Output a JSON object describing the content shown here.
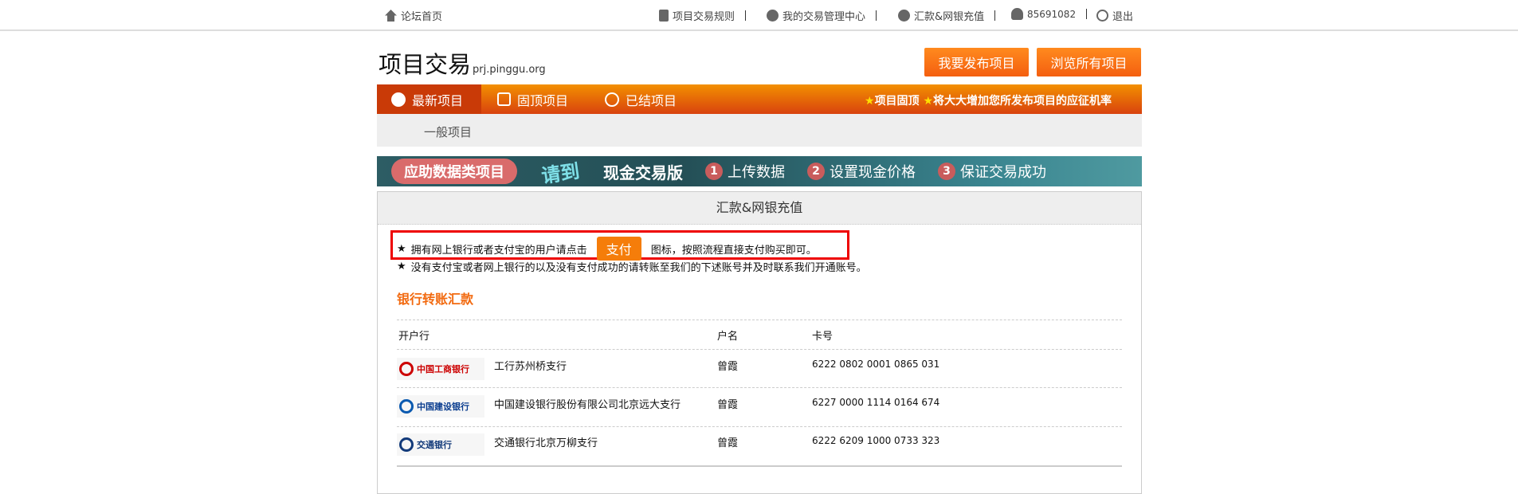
{
  "topbar": {
    "home": "论坛首页",
    "rules": "项目交易规则",
    "manage": "我的交易管理中心",
    "recharge": "汇款&网银充值",
    "user": "85691082",
    "logout": "退出"
  },
  "header": {
    "title": "项目交易",
    "domain": "prj.pinggu.org",
    "publish_btn": "我要发布项目",
    "browse_btn": "浏览所有项目"
  },
  "nav": {
    "tabs": [
      {
        "label": "最新项目"
      },
      {
        "label": "固顶项目"
      },
      {
        "label": "已结项目"
      }
    ],
    "promo_1": "项目固顶",
    "promo_2": "将大大增加您所发布项目的应征机率",
    "sub": "一般项目"
  },
  "banner": {
    "tag": "应助数据类项目",
    "invite": "请到",
    "edition": "现金交易版",
    "steps": [
      "上传数据",
      "设置现金价格",
      "保证交易成功"
    ]
  },
  "panel": {
    "title": "汇款&网银充值",
    "line1_a": "拥有网上银行或者支付宝的用户请点击",
    "pay": "支付",
    "line1_b": "图标，按照流程直接支付购买即可。",
    "line2": "没有支付宝或者网上银行的以及没有支付成功的请转账至我们的下述账号并及时联系我们开通账号。",
    "section": "银行转账汇款",
    "columns": [
      "开户行",
      "户名",
      "卡号"
    ],
    "rows": [
      {
        "logo": "中国工商银行",
        "branch": "工行苏州桥支行",
        "name": "曾霞",
        "card": "6222 0802 0001 0865 031"
      },
      {
        "logo": "中国建设银行",
        "branch": "中国建设银行股份有限公司北京远大支行",
        "name": "曾霞",
        "card": "6227 0000 1114 0164 674"
      },
      {
        "logo": "交通银行",
        "branch": "交通银行北京万柳支行",
        "name": "曾霞",
        "card": "6222 6209 1000 0733 323"
      }
    ]
  },
  "colors": {
    "accent": "#f57d0a",
    "nav_start": "#f39000",
    "nav_end": "#d8420e",
    "highlight": "#ee0000"
  }
}
